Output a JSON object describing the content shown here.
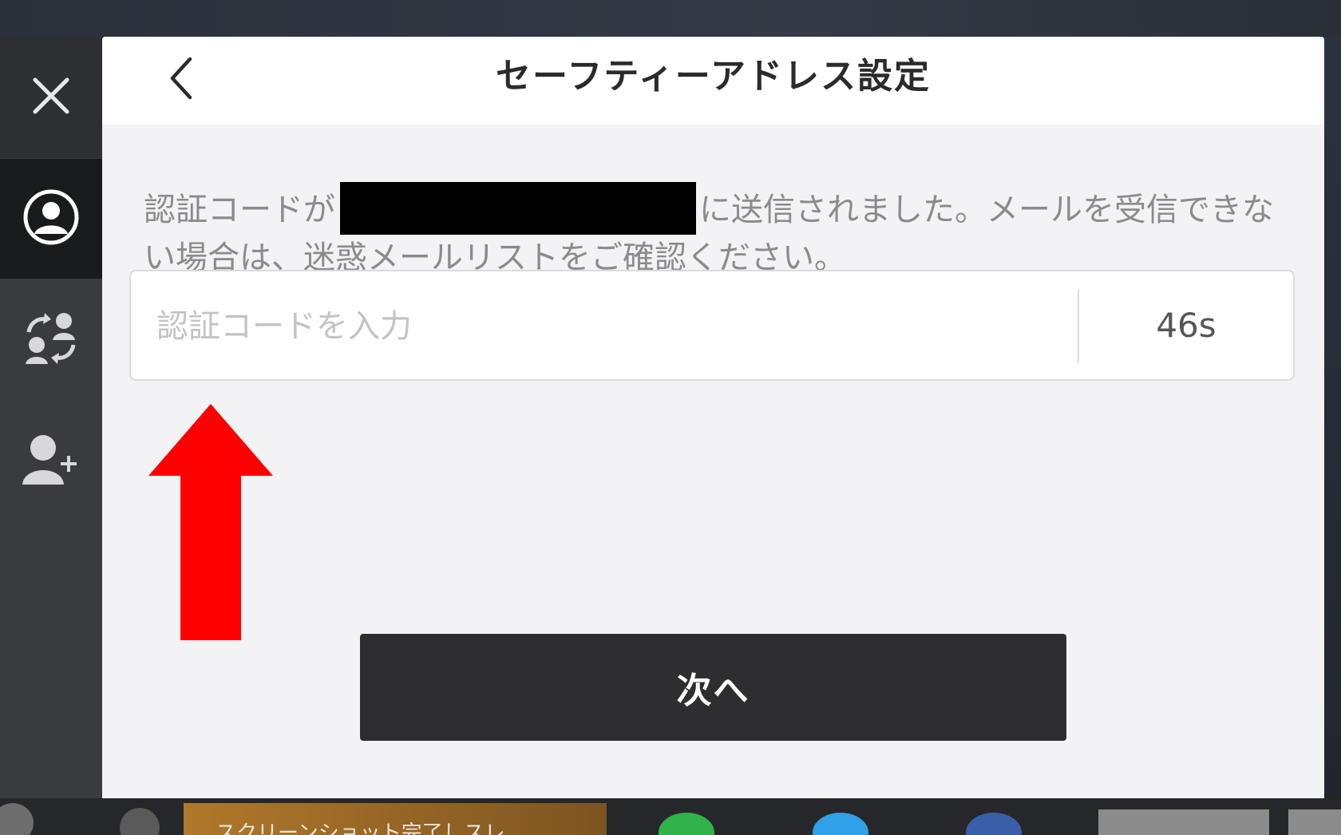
{
  "sidebar": {
    "items": [
      {
        "name": "close",
        "icon": "close-icon"
      },
      {
        "name": "profile",
        "icon": "user-circle-icon",
        "active": true
      },
      {
        "name": "switch-account",
        "icon": "switch-users-icon"
      },
      {
        "name": "add-user",
        "icon": "add-user-icon"
      }
    ]
  },
  "header": {
    "back_icon": "chevron-left-icon",
    "title": "セーフティーアドレス設定"
  },
  "main": {
    "info_before": "認証コードが",
    "info_after": "に送信されました。メールを受信できない場合は、迷惑メールリストをご確認ください。",
    "code_input": {
      "placeholder": "認証コードを入力",
      "value": ""
    },
    "timer": "46s",
    "next_button": "次へ"
  },
  "taskbar": {
    "banner_text": "スクリーンショット完了しスレ"
  },
  "colors": {
    "panel_bg": "#f3f3f5",
    "button_bg": "#2e2e31",
    "arrow": "#ff0000",
    "sidebar_bg": "#3a3b3f"
  }
}
